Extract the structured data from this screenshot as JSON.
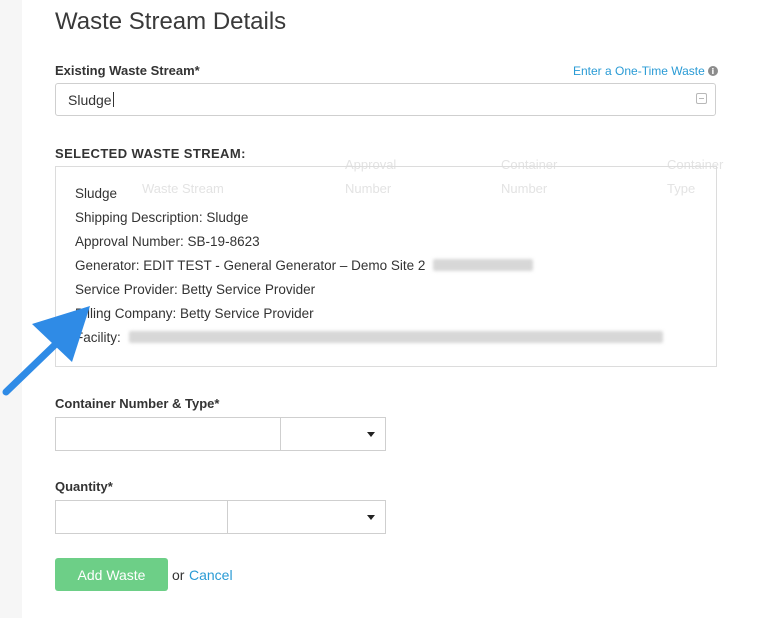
{
  "page_title": "Waste Stream Details",
  "existing_ws": {
    "label": "Existing Waste Stream*",
    "value": "Sludge",
    "one_time_link": "Enter a One-Time Waste",
    "info_glyph": "i"
  },
  "selected": {
    "heading": "SELECTED WASTE STREAM:",
    "name": "Sludge",
    "shipping": "Shipping Description: Sludge",
    "approval": "Approval Number: SB-19-8623",
    "generator": "Generator: EDIT TEST - General Generator – Demo Site 2",
    "service_provider": "Service Provider: Betty Service Provider",
    "billing": "Billing Company: Betty Service Provider",
    "facility": "Facility:"
  },
  "container": {
    "label": "Container Number & Type*"
  },
  "quantity": {
    "label": "Quantity*"
  },
  "actions": {
    "add_label": "Add Waste",
    "or_text": "or",
    "cancel_label": "Cancel"
  },
  "colors": {
    "accent": "#2a9bd5",
    "add_button": "#6dcf87",
    "arrow": "#2f8be6"
  }
}
